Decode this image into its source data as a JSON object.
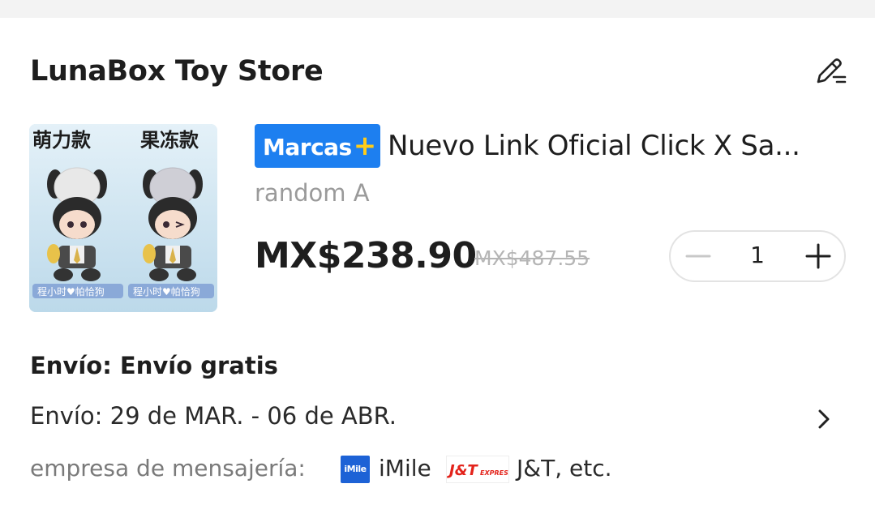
{
  "store": {
    "name": "LunaBox Toy Store"
  },
  "product": {
    "image_labels": [
      "萌力款",
      "果冻款"
    ],
    "image_captions": [
      "程小时♥帕恰狗",
      "程小时♥帕恰狗"
    ],
    "brand_badge": "Marcas",
    "brand_badge_plus": "+",
    "title": "Nuevo Link Oficial Click X Sa...",
    "variant": "random A",
    "price": "MX$238.90",
    "original_price": "MX$487.55",
    "quantity": "1"
  },
  "shipping": {
    "title": "Envío: Envío gratis",
    "date": "Envío: 29 de MAR. - 06 de ABR.",
    "carrier_label": "empresa de mensajería:",
    "carrier1_logo_text": "iMile",
    "carrier1_name": "iMile",
    "carrier2_logo_text": "J&T",
    "carrier2_logo_sub": "EXPRESS",
    "carrier2_name": "J&T, etc."
  },
  "colors": {
    "badge_blue": "#1d7ff0",
    "badge_plus": "#ffcc19",
    "jt_red": "#e3231b",
    "imile_blue": "#1d62d6"
  },
  "icons": [
    "edit-icon",
    "minus-icon",
    "plus-icon",
    "chevron-right-icon"
  ]
}
